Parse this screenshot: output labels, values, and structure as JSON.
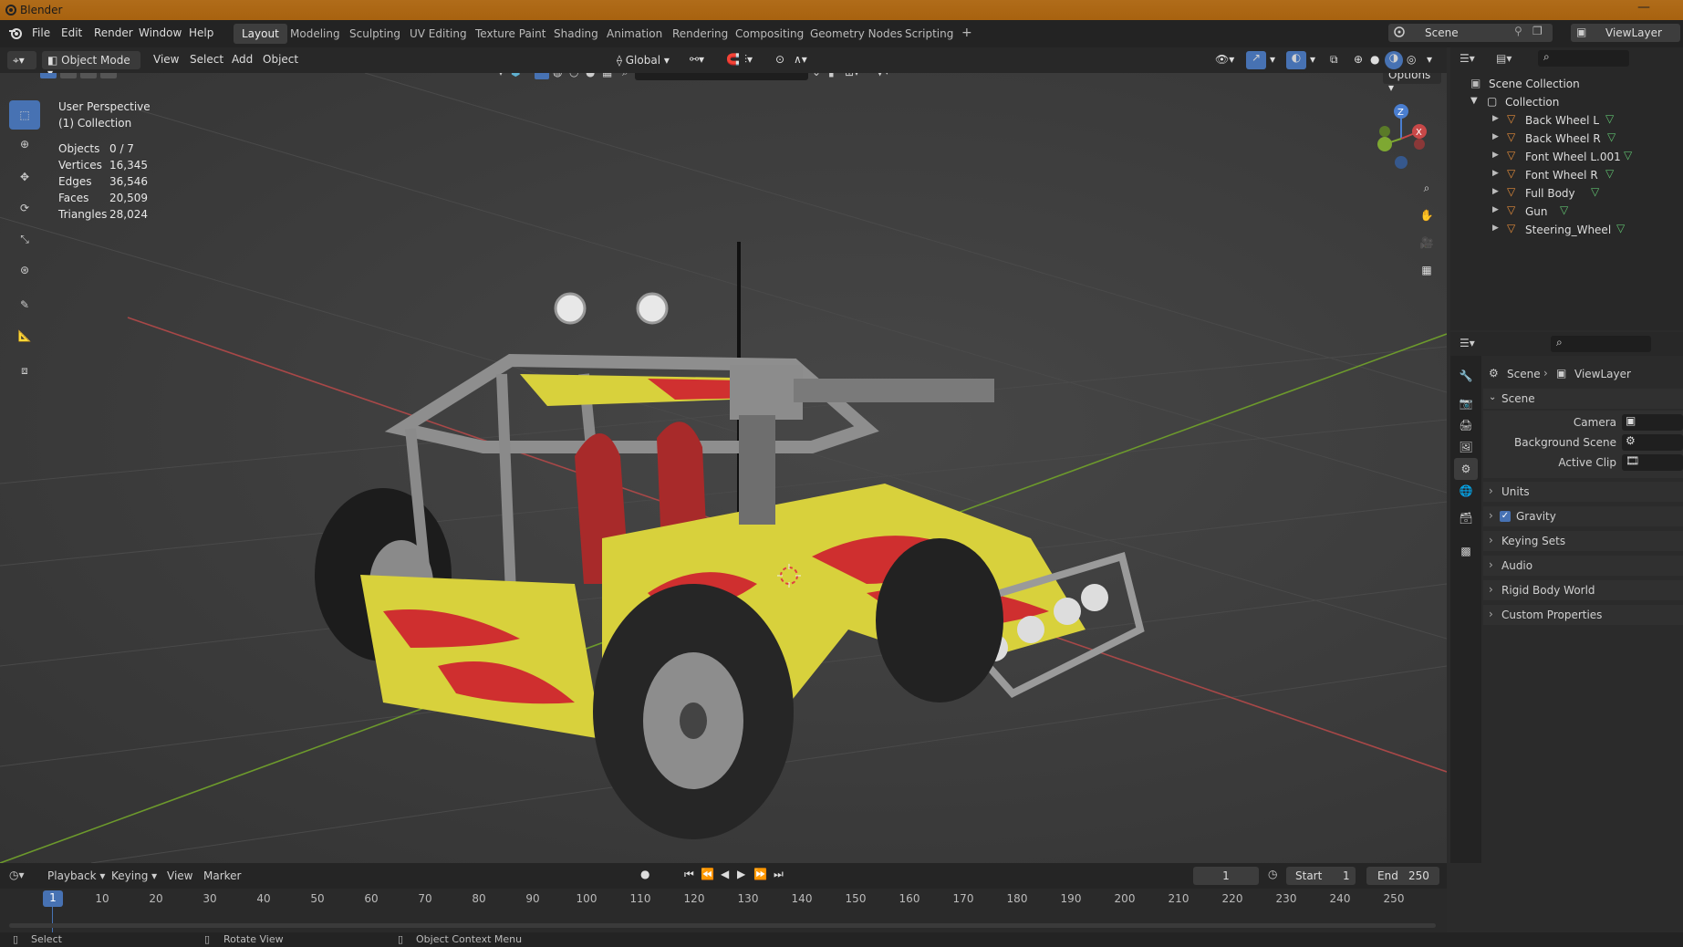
{
  "window": {
    "title": "Blender",
    "min": "—"
  },
  "menu": [
    "File",
    "Edit",
    "Render",
    "Window",
    "Help"
  ],
  "workspaces": [
    "Layout",
    "Modeling",
    "Sculpting",
    "UV Editing",
    "Texture Paint",
    "Shading",
    "Animation",
    "Rendering",
    "Compositing",
    "Geometry Nodes",
    "Scripting",
    "+"
  ],
  "active_workspace": "Layout",
  "scene_selector": "Scene",
  "viewlayer_selector": "ViewLayer",
  "viewport_header": {
    "mode": "Object Mode",
    "view": "View",
    "select": "Select",
    "add": "Add",
    "object": "Object",
    "orientation": "Global",
    "options": "Options"
  },
  "overlay": {
    "perspective": "User Perspective",
    "collection": "(1) Collection",
    "stats": [
      {
        "label": "Objects",
        "value": "0 / 7"
      },
      {
        "label": "Vertices",
        "value": "16,345"
      },
      {
        "label": "Edges",
        "value": "36,546"
      },
      {
        "label": "Faces",
        "value": "20,509"
      },
      {
        "label": "Triangles",
        "value": "28,024"
      }
    ]
  },
  "gizmo": {
    "x": "X",
    "y": "Y",
    "z": "Z"
  },
  "outliner": {
    "root": "Scene Collection",
    "collection": "Collection",
    "items": [
      "Back Wheel L",
      "Back Wheel R",
      "Font Wheel L.001",
      "Font Wheel R",
      "Full Body",
      "Gun",
      "Steering_Wheel"
    ]
  },
  "properties": {
    "breadcrumb_scene": "Scene",
    "breadcrumb_layer": "ViewLayer",
    "panel": "Scene",
    "fields": [
      {
        "label": "Camera"
      },
      {
        "label": "Background Scene"
      },
      {
        "label": "Active Clip"
      }
    ],
    "sections": [
      "Units",
      "Gravity",
      "Keying Sets",
      "Audio",
      "Rigid Body World",
      "Custom Properties"
    ],
    "gravity_checked": true
  },
  "timeline": {
    "menus": [
      "Playback",
      "Keying",
      "View",
      "Marker"
    ],
    "current_frame": "1",
    "start_label": "Start",
    "start": "1",
    "end_label": "End",
    "end": "250",
    "ticks": [
      "10",
      "20",
      "30",
      "40",
      "50",
      "60",
      "70",
      "80",
      "90",
      "100",
      "110",
      "120",
      "130",
      "140",
      "150",
      "160",
      "170",
      "180",
      "190",
      "200",
      "210",
      "220",
      "230",
      "240",
      "250"
    ],
    "playhead": "1"
  },
  "status": {
    "select": "Select",
    "rotate": "Rotate View",
    "context": "Object Context Menu"
  },
  "colors": {
    "accent": "#4772b3",
    "titlebar": "#a8620f",
    "x_axis": "#c84848",
    "y_axis": "#7ea832",
    "z_axis": "#4a7ed0"
  }
}
